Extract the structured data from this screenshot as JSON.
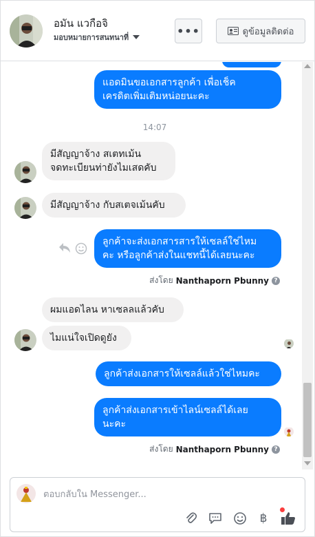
{
  "header": {
    "name": "อมัน แวกือจิ",
    "assignee": "มอบหมายการสนทนาที่",
    "more_label": "•••",
    "contact_label": "ดูข้อมูลติดต่อ"
  },
  "messages": [
    {
      "side": "out",
      "lines": [
        "แอดมินขอเอกสารลูกค้า เพื่อเช็ค",
        "เครดิตเพิ่มเติมหน่อยนะคะ"
      ]
    },
    {
      "side": "timestamp",
      "text": "14:07"
    },
    {
      "side": "in",
      "lines": [
        "มีสัญญาจ้าง  สเตทเม้น",
        "จดทะเบียนท่ายังไมเสดคับ"
      ]
    },
    {
      "side": "in",
      "lines": [
        "มีสัญญาจ้าง  กับสเตจเม้นคับ"
      ]
    },
    {
      "side": "out",
      "lines": [
        "ลูกค้าจะส่งเอกสารสารให้เซลล์ใช่ไหม",
        "คะ หรือลูกค้าส่งในแชทนี้ได้เลยนะคะ"
      ]
    },
    {
      "side": "sent_by",
      "prefix": "ส่งโดย",
      "name": "Nanthaporn Pbunny"
    },
    {
      "side": "in",
      "lines": [
        "ผมแอดไลน หาเซลลแล้วคับ"
      ]
    },
    {
      "side": "in",
      "lines": [
        "ไมแน่ใจเปิดดูยัง"
      ]
    },
    {
      "side": "out",
      "lines": [
        "ลูกค้าส่งเอกสารให้เซลล์แล้วใช่ไหมคะ"
      ]
    },
    {
      "side": "out",
      "lines": [
        "ลูกค้าส่งเอกสารเข้าไลน์เซลล์ได้เลย",
        "นะคะ"
      ]
    },
    {
      "side": "sent_by",
      "prefix": "ส่งโดย",
      "name": "Nanthaporn Pbunny"
    }
  ],
  "composer": {
    "placeholder": "ตอบกลับใน Messenger..."
  },
  "icons": {
    "reply": "reply-icon",
    "emoji_react": "smiley-icon",
    "attach": "paperclip-icon",
    "saved_replies": "chat-bubble-icon",
    "emoji": "emoji-icon",
    "payment": "baht-icon",
    "like": "thumbs-up-icon"
  },
  "colors": {
    "outgoing_bubble": "#0a7cff",
    "incoming_bubble": "#f1f0f0",
    "notification_dot": "#fa3e3e"
  }
}
